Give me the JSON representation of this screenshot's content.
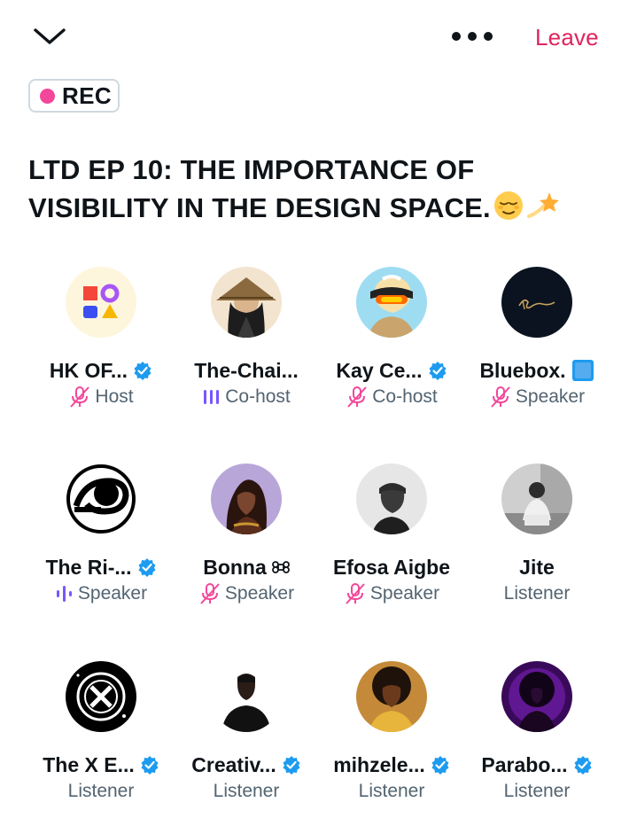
{
  "header": {
    "leave_label": "Leave"
  },
  "recording": {
    "label": "REC",
    "dot_color": "#f2479a"
  },
  "space": {
    "title": "LTD EP 10: THE IMPORTANCE OF VISIBILITY IN THE DESIGN SPACE.",
    "title_emojis": [
      "relieved-face-emoji",
      "dizzy-star-emoji"
    ]
  },
  "participants": [
    {
      "name": "HK OF...",
      "role": "Host",
      "verified": true,
      "status_icon": "mic-off-icon",
      "avatar": "shapes-logo-avatar"
    },
    {
      "name": "The-Chai...",
      "role": "Co-host",
      "verified": false,
      "status_icon": "speaking-icon",
      "avatar": "conical-hat-avatar"
    },
    {
      "name": "Kay Ce...",
      "role": "Co-host",
      "verified": true,
      "status_icon": "mic-off-icon",
      "avatar": "sunglasses-avatar"
    },
    {
      "name": "Bluebox.",
      "role": "Speaker",
      "verified": false,
      "status_icon": "mic-off-icon",
      "avatar": "bluebox-logo-avatar",
      "name_suffix_icon": "blue-square-icon"
    },
    {
      "name": "The Ri-...",
      "role": "Speaker",
      "verified": true,
      "status_icon": "speaking-icon",
      "avatar": "spiral-logo-avatar"
    },
    {
      "name": "Bonna",
      "role": "Speaker",
      "verified": false,
      "status_icon": "mic-off-icon",
      "avatar": "elf-portrait-avatar",
      "name_suffix_icon": "command-icon"
    },
    {
      "name": "Efosa Aigbe",
      "role": "Speaker",
      "verified": false,
      "status_icon": "mic-off-icon",
      "avatar": "cap-man-avatar"
    },
    {
      "name": "Jite",
      "role": "Listener",
      "verified": false,
      "status_icon": null,
      "avatar": "bw-photo-avatar"
    },
    {
      "name": "The X E...",
      "role": "Listener",
      "verified": true,
      "status_icon": null,
      "avatar": "x-logo-avatar"
    },
    {
      "name": "Creativ...",
      "role": "Listener",
      "verified": true,
      "status_icon": null,
      "avatar": "man-black-shirt-avatar"
    },
    {
      "name": "mihzele...",
      "role": "Listener",
      "verified": true,
      "status_icon": null,
      "avatar": "afro-woman-avatar"
    },
    {
      "name": "Parabo...",
      "role": "Listener",
      "verified": true,
      "status_icon": null,
      "avatar": "purple-silhouette-avatar"
    }
  ],
  "colors": {
    "leave": "#e0245e",
    "verified": "#1d9bf0",
    "mic_off": "#f2479a",
    "speaking": "#7856ff",
    "secondary_text": "#536471"
  }
}
